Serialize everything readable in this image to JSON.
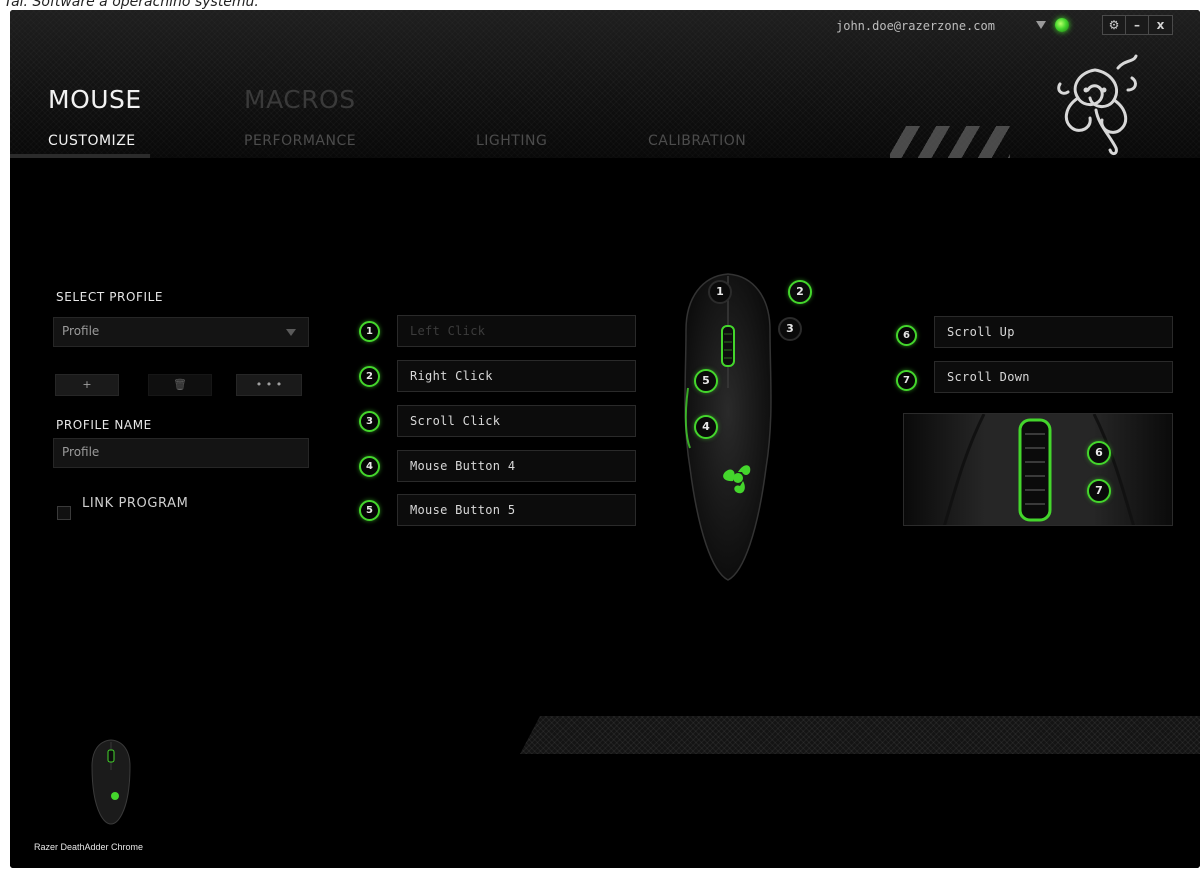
{
  "document": {
    "caption": "Tal. Software a operacníno systému."
  },
  "header": {
    "account_email": "john.doe@razerzone.com",
    "window_controls": {
      "settings": "⚙",
      "minimize": "–",
      "close": "x"
    },
    "main_tabs": [
      {
        "label": "MOUSE",
        "active": true
      },
      {
        "label": "MACROS",
        "active": false
      }
    ],
    "sub_tabs": [
      {
        "label": "CUSTOMIZE",
        "active": true
      },
      {
        "label": "PERFORMANCE",
        "active": false
      },
      {
        "label": "LIGHTING",
        "active": false
      },
      {
        "label": "CALIBRATION",
        "active": false
      }
    ]
  },
  "left_panel": {
    "select_profile_label": "SELECT PROFILE",
    "profile_dropdown_value": "Profile",
    "profile_buttons": {
      "add": "+",
      "delete": "🗑",
      "more": "• • •"
    },
    "profile_name_label": "PROFILE NAME",
    "profile_name_value": "Profile",
    "link_program_label": "LINK PROGRAM",
    "link_program_checked": false
  },
  "buttons_left": [
    {
      "num": "1",
      "assignment": "Left Click",
      "disabled": true
    },
    {
      "num": "2",
      "assignment": "Right Click",
      "disabled": false
    },
    {
      "num": "3",
      "assignment": "Scroll Click",
      "disabled": false
    },
    {
      "num": "4",
      "assignment": "Mouse Button 4",
      "disabled": false
    },
    {
      "num": "5",
      "assignment": "Mouse Button 5",
      "disabled": false
    }
  ],
  "buttons_right": [
    {
      "num": "6",
      "assignment": "Scroll Up"
    },
    {
      "num": "7",
      "assignment": "Scroll Down"
    }
  ],
  "mouse_callouts": [
    "1",
    "2",
    "3",
    "5",
    "4"
  ],
  "zoom_callouts": [
    "6",
    "7"
  ],
  "footer": {
    "device_name": "Razer DeathAdder Chrome"
  },
  "colors": {
    "accent": "#44d62c",
    "background": "#000000",
    "text": "#e6e6e6",
    "inactive_text": "#4c4c4c"
  }
}
